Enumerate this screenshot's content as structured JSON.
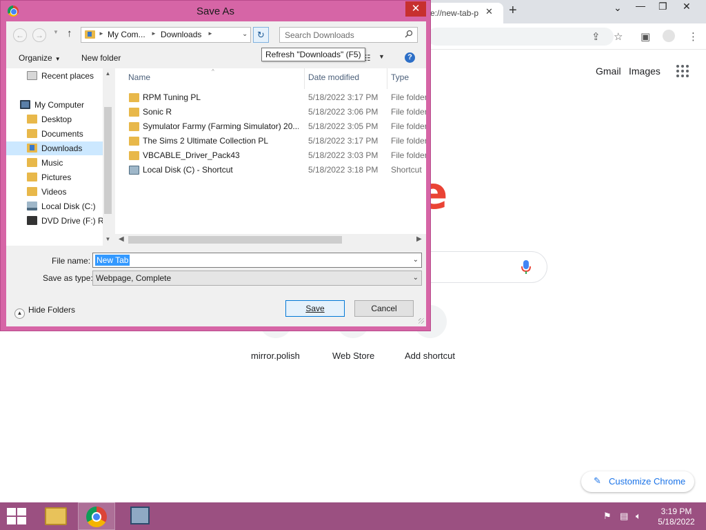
{
  "chrome": {
    "tab_title": "e://new-tab-p",
    "links": [
      "Gmail",
      "Images"
    ],
    "shortcuts": [
      "mirror.polish",
      "Web Store",
      "Add shortcut"
    ],
    "customize_label": "Customize Chrome"
  },
  "dialog": {
    "title": "Save As",
    "address": {
      "crumbs": [
        "My Com...",
        "Downloads"
      ]
    },
    "search_placeholder": "Search Downloads",
    "tooltip": "Refresh \"Downloads\" (F5)",
    "toolbar": {
      "organize_label": "Organize",
      "new_folder_label": "New folder"
    },
    "nav_items": [
      {
        "label": "Recent places",
        "icon": "recent-places-icon"
      },
      {
        "label": "My Computer",
        "icon": "computer-icon"
      },
      {
        "label": "Desktop",
        "icon": "folder-icon"
      },
      {
        "label": "Documents",
        "icon": "folder-icon"
      },
      {
        "label": "Downloads",
        "icon": "downloads-folder-icon",
        "selected": true
      },
      {
        "label": "Music",
        "icon": "folder-icon"
      },
      {
        "label": "Pictures",
        "icon": "folder-icon"
      },
      {
        "label": "Videos",
        "icon": "folder-icon"
      },
      {
        "label": "Local Disk (C:)",
        "icon": "disk-icon"
      },
      {
        "label": "DVD Drive (F:) RP",
        "icon": "dvd-icon"
      }
    ],
    "columns": [
      "Name",
      "Date modified",
      "Type"
    ],
    "files": [
      {
        "name": "RPM Tuning PL",
        "date": "5/18/2022 3:17 PM",
        "type": "File folder"
      },
      {
        "name": "Sonic R",
        "date": "5/18/2022 3:06 PM",
        "type": "File folder"
      },
      {
        "name": "Symulator Farmy (Farming Simulator) 20...",
        "date": "5/18/2022 3:05 PM",
        "type": "File folder"
      },
      {
        "name": "The Sims 2 Ultimate Collection PL",
        "date": "5/18/2022 3:17 PM",
        "type": "File folder"
      },
      {
        "name": "VBCABLE_Driver_Pack43",
        "date": "5/18/2022 3:03 PM",
        "type": "File folder"
      },
      {
        "name": "Local Disk (C) - Shortcut",
        "date": "5/18/2022 3:18 PM",
        "type": "Shortcut"
      }
    ],
    "file_name_label": "File name:",
    "file_name_value": "New Tab",
    "save_type_label": "Save as type:",
    "save_type_value": "Webpage, Complete",
    "hide_folders_label": "Hide Folders",
    "save_label": "Save",
    "cancel_label": "Cancel"
  },
  "taskbar": {
    "time": "3:19 PM",
    "date": "5/18/2022",
    "color": "#9b5081"
  },
  "colors": {
    "dialog_frame": "#d665a6",
    "selection": "#3399ff",
    "close_button": "#c7302f"
  }
}
